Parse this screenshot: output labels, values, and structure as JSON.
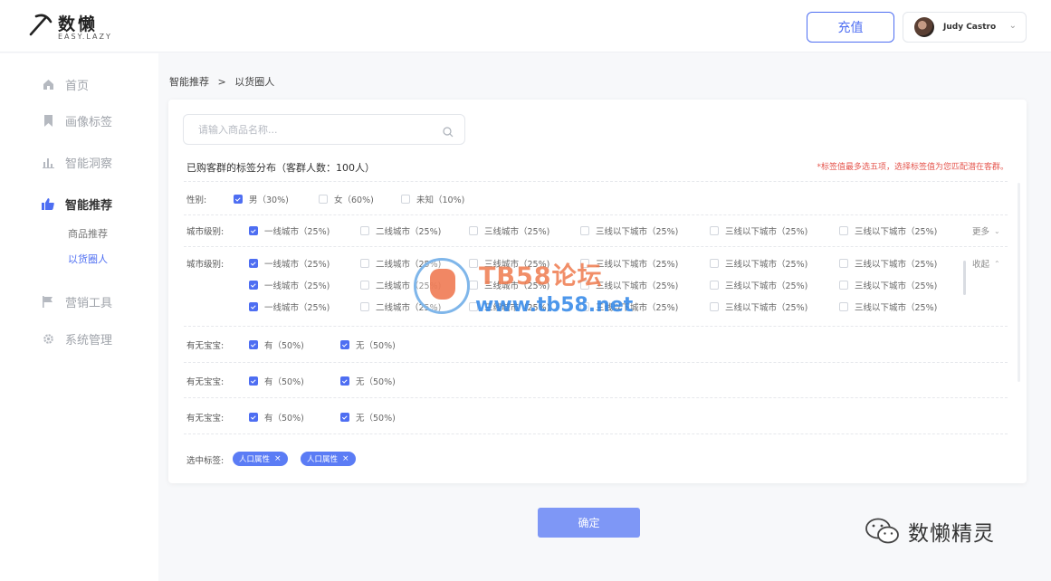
{
  "header": {
    "logo_cn": "数懒",
    "logo_en": "EASY.LAZY",
    "recharge_label": "充值",
    "user_name": "Judy Castro"
  },
  "sidebar": {
    "items": [
      {
        "label": "首页",
        "icon": "home-icon"
      },
      {
        "label": "画像标签",
        "icon": "bookmark-icon"
      },
      {
        "label": "智能洞察",
        "icon": "bar-chart-icon"
      },
      {
        "label": "智能推荐",
        "icon": "thumbs-up-icon",
        "active": true
      },
      {
        "label": "营销工具",
        "icon": "flag-icon"
      },
      {
        "label": "系统管理",
        "icon": "gear-icon"
      }
    ],
    "sub_items": [
      {
        "label": "商品推荐"
      },
      {
        "label": "以货圈人",
        "active": true
      }
    ]
  },
  "breadcrumb": {
    "parent": "智能推荐",
    "separator": ">",
    "current": "以货圈人"
  },
  "search": {
    "placeholder": "请输入商品名称..."
  },
  "distribution": {
    "title": "已购客群的标签分布（客群人数：100人）",
    "note": "*标签值最多选五项，选择标签值为您匹配潜在客群。"
  },
  "filters": {
    "gender": {
      "label": "性别:",
      "options": [
        {
          "text": "男（30%)",
          "checked": true
        },
        {
          "text": "女（60%)",
          "checked": false
        },
        {
          "text": "未知（10%)",
          "checked": false
        }
      ]
    },
    "city1": {
      "label": "城市级别:",
      "toggle": "更多",
      "options": [
        {
          "text": "一线城市（25%)",
          "checked": true
        },
        {
          "text": "二线城市（25%)",
          "checked": false
        },
        {
          "text": "三线城市（25%)",
          "checked": false
        },
        {
          "text": "三线以下城市（25%)",
          "checked": false
        },
        {
          "text": "三线以下城市（25%)",
          "checked": false
        },
        {
          "text": "三线以下城市（25%)",
          "checked": false
        }
      ]
    },
    "city2": {
      "label": "城市级别:",
      "toggle": "收起",
      "rows": [
        [
          {
            "text": "一线城市（25%)",
            "checked": true
          },
          {
            "text": "二线城市（25%)",
            "checked": false
          },
          {
            "text": "三线城市（25%)",
            "checked": false
          },
          {
            "text": "三线以下城市（25%)",
            "checked": false
          },
          {
            "text": "三线以下城市（25%)",
            "checked": false
          },
          {
            "text": "三线以下城市（25%)",
            "checked": false
          }
        ],
        [
          {
            "text": "一线城市（25%)",
            "checked": true
          },
          {
            "text": "二线城市（25%)",
            "checked": false
          },
          {
            "text": "三线城市（25%)",
            "checked": false
          },
          {
            "text": "三线以下城市（25%)",
            "checked": false
          },
          {
            "text": "三线以下城市（25%)",
            "checked": false
          },
          {
            "text": "三线以下城市（25%)",
            "checked": false
          }
        ],
        [
          {
            "text": "一线城市（25%)",
            "checked": true
          },
          {
            "text": "二线城市（25%)",
            "checked": false
          },
          {
            "text": "三线城市（25%)",
            "checked": false
          },
          {
            "text": "三线以下城市（25%)",
            "checked": false
          },
          {
            "text": "三线以下城市（25%)",
            "checked": false
          },
          {
            "text": "三线以下城市（25%)",
            "checked": false
          }
        ]
      ]
    },
    "baby_rows": [
      {
        "label": "有无宝宝:",
        "options": [
          {
            "text": "有（50%)",
            "checked": true
          },
          {
            "text": "无（50%)",
            "checked": true
          }
        ]
      },
      {
        "label": "有无宝宝:",
        "options": [
          {
            "text": "有（50%)",
            "checked": true
          },
          {
            "text": "无（50%)",
            "checked": true
          }
        ]
      },
      {
        "label": "有无宝宝:",
        "options": [
          {
            "text": "有（50%)",
            "checked": true
          },
          {
            "text": "无（50%)",
            "checked": true
          }
        ]
      }
    ]
  },
  "selected": {
    "label": "选中标签:",
    "tags": [
      "人口属性",
      "人口属性"
    ]
  },
  "confirm_label": "确定",
  "watermark": {
    "forum_name": "TB58论坛",
    "forum_url": "www.tb58.net",
    "account_name": "数懒精灵"
  },
  "colors": {
    "accent": "#4e6ef2",
    "note_red": "#e5564e",
    "tag_bg": "#5b7cf5",
    "confirm_bg": "#7e97f6"
  }
}
